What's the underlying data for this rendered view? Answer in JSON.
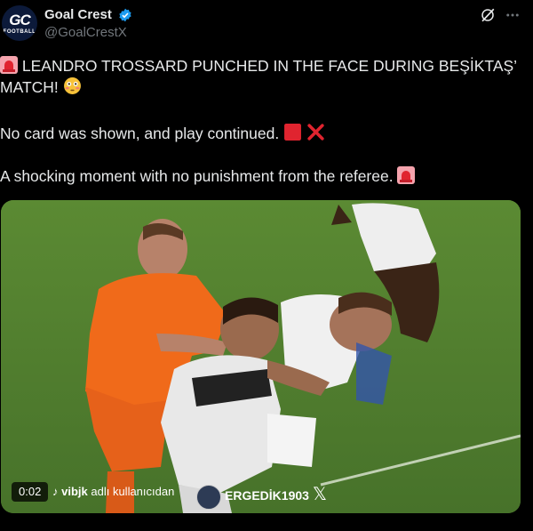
{
  "author": {
    "avatar_text": "GC",
    "avatar_subtext": "FOOTBALL",
    "name": "Goal Crest",
    "handle": "@GoalCrestX"
  },
  "icons": {
    "verified": "verified-badge-icon",
    "grok": "grok-icon",
    "more": "more-options-icon",
    "siren": "siren-emoji",
    "flushed": "flushed-face-emoji",
    "red_square": "red-square-emoji",
    "cross": "cross-mark-emoji"
  },
  "tweet": {
    "line1": "LEANDRO TROSSARD PUNCHED IN THE FACE DURING BEŞİKTAŞ’",
    "line2": "MATCH!",
    "line3": "No card was shown, and play continued.",
    "line4": "A shocking moment with no punishment from the referee."
  },
  "media": {
    "time": "0:02",
    "credit_user": "vibjk",
    "credit_suffix": "adlı kullanıcıdan",
    "watermark": "ERGEDİK1903"
  },
  "colors": {
    "background": "#000000",
    "text": "#e7e9ea",
    "muted": "#71767b",
    "verified": "#1d9bf0",
    "pitch": "#4f7a2c",
    "orange_kit": "#f06a1a"
  }
}
